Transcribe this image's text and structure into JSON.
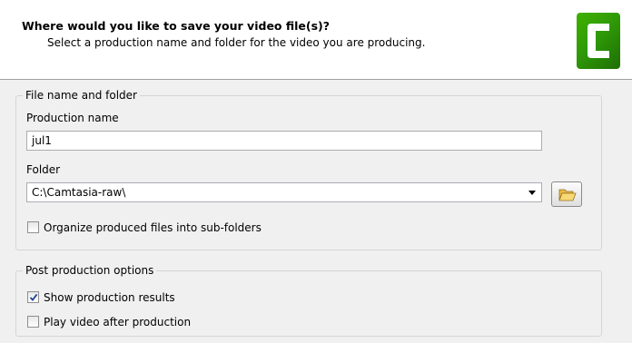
{
  "header": {
    "title": "Where would you like to save your video file(s)?",
    "subtitle": "Select a production name and folder for the video you are producing.",
    "logo_icon": "camtasia-logo"
  },
  "file_group": {
    "legend": "File name and folder",
    "production_name_label": "Production name",
    "production_name_value": "jul1",
    "folder_label": "Folder",
    "folder_value": "C:\\Camtasia-raw\\",
    "browse_icon": "folder-open-icon",
    "organize_label": "Organize produced files into sub-folders",
    "organize_checked": false
  },
  "post_group": {
    "legend": "Post production options",
    "show_results_label": "Show production results",
    "show_results_checked": true,
    "play_video_label": "Play video after production",
    "play_video_checked": false
  }
}
